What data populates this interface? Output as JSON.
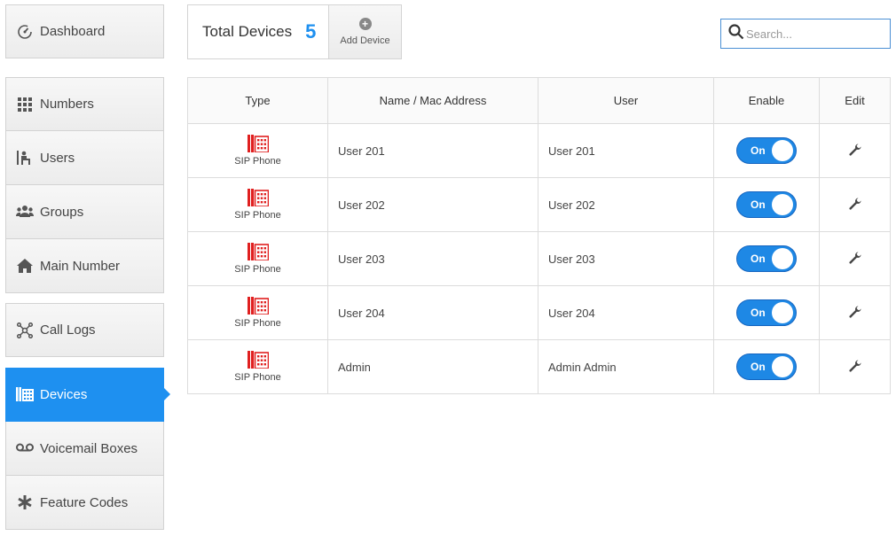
{
  "sidebar": {
    "groups": [
      [
        {
          "label": "Dashboard",
          "icon": "dashboard-icon"
        }
      ],
      [
        {
          "label": "Numbers",
          "icon": "grid-icon"
        },
        {
          "label": "Users",
          "icon": "user-seat-icon"
        },
        {
          "label": "Groups",
          "icon": "group-icon"
        },
        {
          "label": "Main Number",
          "icon": "home-icon"
        }
      ],
      [
        {
          "label": "Call Logs",
          "icon": "network-icon"
        },
        {
          "label": "Devices",
          "icon": "device-icon",
          "active": true
        },
        {
          "label": "Voicemail Boxes",
          "icon": "voicemail-icon"
        },
        {
          "label": "Feature Codes",
          "icon": "asterisk-icon"
        }
      ]
    ]
  },
  "header": {
    "total_label": "Total Devices",
    "total_count": "5",
    "add_device_label": "Add Device",
    "search_placeholder": "Search..."
  },
  "table": {
    "columns": [
      "Type",
      "Name / Mac Address",
      "User",
      "Enable",
      "Edit"
    ],
    "rows": [
      {
        "type": "SIP Phone",
        "name": "User 201",
        "user": "User 201",
        "enable": "On"
      },
      {
        "type": "SIP Phone",
        "name": "User 202",
        "user": "User 202",
        "enable": "On"
      },
      {
        "type": "SIP Phone",
        "name": "User 203",
        "user": "User 203",
        "enable": "On"
      },
      {
        "type": "SIP Phone",
        "name": "User 204",
        "user": "User 204",
        "enable": "On"
      },
      {
        "type": "SIP Phone",
        "name": "Admin",
        "user": "Admin Admin",
        "enable": "On"
      }
    ]
  },
  "colors": {
    "accent": "#1e90f0",
    "toggle_on": "#1e88e5",
    "phone_icon": "#e02020"
  }
}
